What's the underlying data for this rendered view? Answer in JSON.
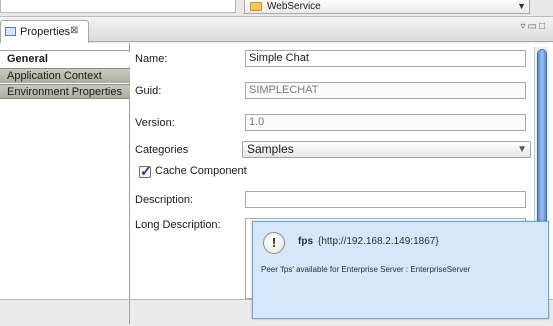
{
  "top": {
    "combo_value": "WebService"
  },
  "view": {
    "tab_label": "Properties",
    "tab_close": "⊠",
    "view_menu_icon": "view-menu-icon",
    "minimize_icon": "minimize-icon",
    "maximize_icon": "maximize-icon"
  },
  "sections": [
    {
      "label": "General",
      "active": true
    },
    {
      "label": "Application Context",
      "active": false
    },
    {
      "label": "Environment Properties",
      "active": false
    }
  ],
  "form": {
    "name_label": "Name:",
    "name_value": "Simple Chat",
    "guid_label": "Guid:",
    "guid_value": "SIMPLECHAT",
    "version_label": "Version:",
    "version_value": "1.0",
    "categories_label": "Categories",
    "categories_value": "Samples",
    "cache_label": "Cache Component",
    "cache_checked": true,
    "description_label": "Description:",
    "description_value": "",
    "long_description_label": "Long Description:",
    "long_description_value": ""
  },
  "notification": {
    "icon": "!",
    "peer_name": "fps",
    "peer_address": "{http://192.168.2.149:1867}",
    "message": "Peer 'fps' available for Enterprise Server : EnterpriseServer"
  }
}
